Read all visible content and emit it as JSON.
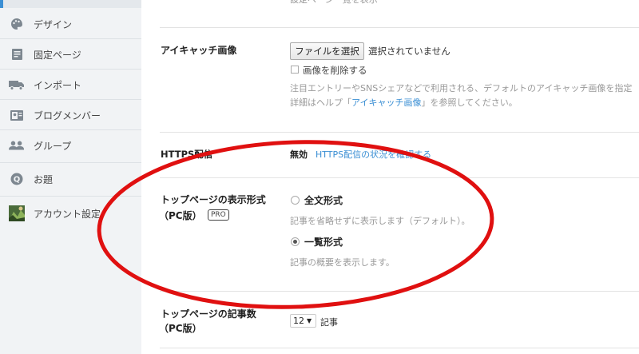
{
  "sidebar": {
    "items": [
      {
        "label": "デザイン",
        "icon": "palette-icon"
      },
      {
        "label": "固定ページ",
        "icon": "page-icon"
      },
      {
        "label": "インポート",
        "icon": "truck-icon"
      },
      {
        "label": "ブログメンバー",
        "icon": "member-icon"
      },
      {
        "label": "グループ",
        "icon": "group-icon"
      },
      {
        "label": "お題",
        "icon": "theme-icon"
      },
      {
        "label": "アカウント設定",
        "icon": "avatar-icon"
      }
    ]
  },
  "settings": {
    "eyecatch": {
      "label": "アイキャッチ画像",
      "file_button": "ファイルを選択",
      "file_status": "選択されていません",
      "delete_label": "画像を削除する",
      "note_line1": "注目エントリーやSNSシェアなどで利用される、デフォルトのアイキャッチ画像を指定",
      "note_prefix": "詳細はヘルプ「",
      "note_link": "アイキャッチ画像",
      "note_suffix": "」を参照してください。"
    },
    "https": {
      "label": "HTTPS配信",
      "status": "無効",
      "link": "HTTPS配信の状況を確認する"
    },
    "top_display": {
      "label_line1": "トップページの表示形式",
      "label_line2": "（PC版）",
      "badge": "PRO",
      "options": [
        {
          "label": "全文形式",
          "desc": "記事を省略せずに表示します（デフォルト）。",
          "checked": false
        },
        {
          "label": "一覧形式",
          "desc": "記事の概要を表示します。",
          "checked": true
        }
      ]
    },
    "top_count": {
      "label_line1": "トップページの記事数",
      "label_line2": "（PC版）",
      "value": "12",
      "unit": "記事"
    }
  },
  "colors": {
    "link": "#3b8fd4",
    "annotation": "#e01010",
    "sidebar_bg": "#f1f3f5"
  }
}
